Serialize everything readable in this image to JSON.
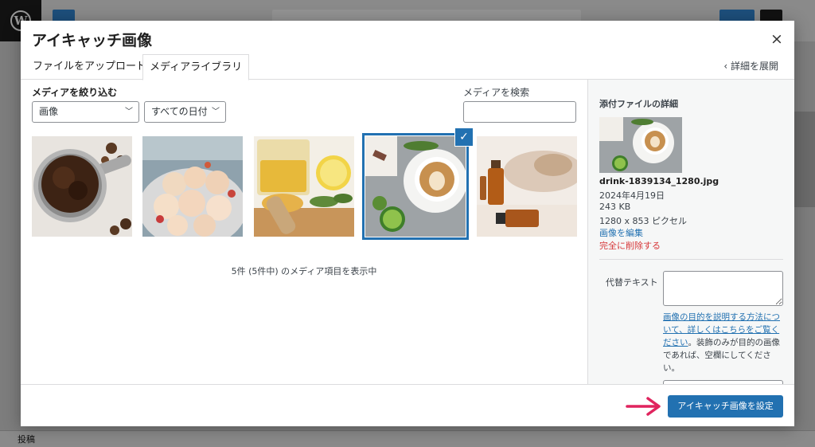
{
  "background": {
    "footer_label": "投稿"
  },
  "modal": {
    "title": "アイキャッチ画像",
    "close_label": "×",
    "tabs": [
      {
        "label": "ファイルをアップロード",
        "active": false
      },
      {
        "label": "メディアライブラリ",
        "active": true
      }
    ],
    "expand_label": "‹  詳細を展開"
  },
  "filters": {
    "heading": "メディアを絞り込む",
    "type_value": "画像",
    "date_value": "すべての日付",
    "search_label": "メディアを検索",
    "search_value": ""
  },
  "media": {
    "items": [
      {
        "icon": "coffee-grounds-image",
        "selected": false
      },
      {
        "icon": "macarons-image",
        "selected": false
      },
      {
        "icon": "honey-lemon-image",
        "selected": false
      },
      {
        "icon": "latte-lime-image",
        "selected": true
      },
      {
        "icon": "amber-bottles-image",
        "selected": false
      }
    ],
    "check_glyph": "✓",
    "count_text": "5件 (5件中) のメディア項目を表示中"
  },
  "details": {
    "heading": "添付ファイルの詳細",
    "filename": "drink-1839134_1280.jpg",
    "date": "2024年4月19日",
    "size": "243 KB",
    "dimensions": "1280 x 853 ピクセル",
    "edit_label": "画像を編集",
    "delete_label": "完全に削除する",
    "alt_label": "代替テキスト",
    "alt_value": "",
    "help_link": "画像の目的を説明する方法について、詳しくはこちらをご覧ください",
    "help_text": "。装飾のみが目的の画像であれば、空欄にしてください。"
  },
  "toolbar": {
    "set_button": "アイキャッチ画像を設定"
  },
  "colors": {
    "accent": "#2271b1",
    "danger": "#d63638",
    "arrow": "#e0245e"
  }
}
